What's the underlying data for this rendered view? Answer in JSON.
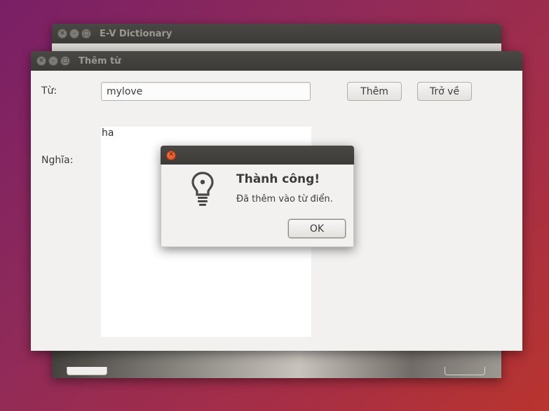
{
  "background_window": {
    "title": "E-V Dictionary",
    "controls": [
      "close",
      "minimize",
      "maximize"
    ]
  },
  "main_window": {
    "title": "Thêm từ",
    "controls": [
      "close",
      "minimize",
      "maximize"
    ],
    "word_label": "Từ:",
    "word_value": "mylove",
    "add_button": "Thêm",
    "back_button": "Trở về",
    "meaning_label": "Nghĩa:",
    "meaning_value": "ha"
  },
  "dialog": {
    "icon": "lightbulb-icon",
    "title": "Thành công!",
    "message": "Đã thêm vào từ điển.",
    "ok_button": "OK"
  },
  "colors": {
    "titlebar": "#3c3b37",
    "window_bg": "#f2f1f0",
    "close_button": "#e2541f"
  }
}
